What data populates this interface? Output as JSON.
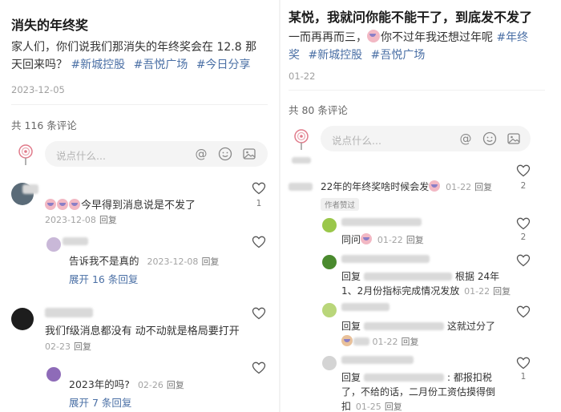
{
  "left": {
    "post": {
      "title": "消失的年终奖",
      "body_line1": "家人们，你们说我们那消失的年终奖会在 12.8 那",
      "body_line2_prefix": "天回来吗？",
      "tags_line2": [
        "#新城控股",
        "#吾悦广场",
        "#今日分享"
      ],
      "date": "2023-12-05"
    },
    "comment_count": "共 116 条评论",
    "input_placeholder": "说点什么...",
    "comments": [
      {
        "text": "今早得到消息说是不发了",
        "date": "2023-12-08",
        "reply": "回复",
        "likes": "1",
        "sub": {
          "text": "告诉我不是真的",
          "date": "2023-12-08",
          "reply": "回复",
          "expand": "展开 16 条回复"
        }
      },
      {
        "text": "我们f级消息都没有 动不动就是格局要打开",
        "date": "02-23",
        "reply": "回复",
        "sub": {
          "text": "2023年的吗?",
          "date": "02-26",
          "reply": "回复",
          "expand": "展开 7 条回复"
        }
      }
    ]
  },
  "right": {
    "post": {
      "title": "某悦，我就问你能不能干了，到底发不发了",
      "body_line1_a": "一而再再而三，",
      "body_line1_b": "你不过年我还想过年呢",
      "tag_inline": "#年终",
      "tag_inline_2": "奖",
      "tags_line2": [
        "#新城控股",
        "#吾悦广场"
      ],
      "date": "01-22"
    },
    "comment_count": "共 80 条评论",
    "input_placeholder": "说点什么...",
    "comments": [
      {
        "text": "22年的年终奖啥时候会发",
        "date": "01-22",
        "reply": "回复",
        "likes": "2",
        "badge": "作者赞过"
      },
      {
        "text": "同问",
        "date": "01-22",
        "reply": "回复",
        "likes": "2"
      },
      {
        "line1_prefix": "回复",
        "line1_suffix": "根据 24年",
        "line2": "1、2月份指标完成情况发放",
        "date": "01-22",
        "reply": "回复"
      },
      {
        "line1_prefix": "回复",
        "line1_suffix": "这就过分了",
        "date": "01-22",
        "reply": "回复"
      },
      {
        "line1_prefix": "回复",
        "line1_suffix": ": 都报扣税",
        "line2": "了，不给的话，二月份工资估摸得倒",
        "line3": "扣",
        "date": "01-25",
        "reply": "回复",
        "likes": "1"
      }
    ]
  },
  "colors": {
    "tag": "#4a6fa5",
    "meta": "#a3a3a3",
    "input_bg": "#f4f4f4"
  },
  "icons": [
    "at-icon",
    "smile-icon",
    "image-icon",
    "heart-icon",
    "lollipop-avatar-icon"
  ]
}
